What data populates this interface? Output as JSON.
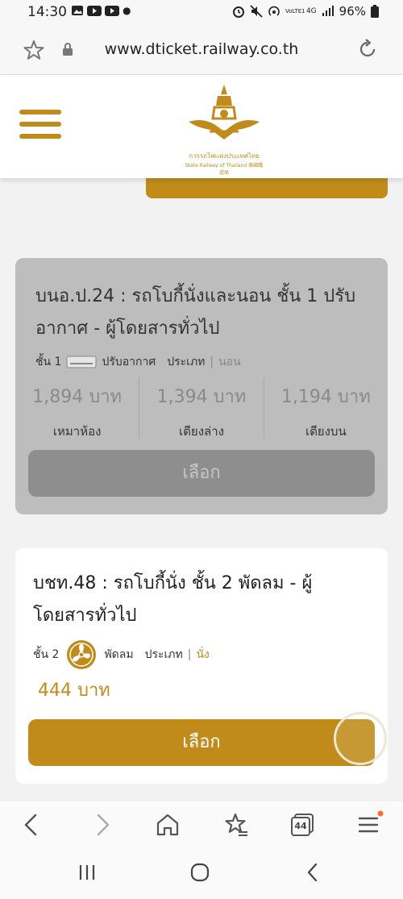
{
  "status_bar": {
    "time": "14:30",
    "network": "4G",
    "volte": "VoLTE1",
    "battery": "96%"
  },
  "browser": {
    "url": "www.dticket.railway.co.th",
    "tab_count": "44"
  },
  "header": {
    "logo_text_th": "การรถไฟแห่งประเทศไทย",
    "logo_text_en": "State Railway of Thailand 泰國鐵道局"
  },
  "card1": {
    "title": "บนอ.ป.24 : รถโบกี้นั่งและนอน ชั้น 1 ปรับอากาศ - ผู้โดยสารทั่วไป",
    "class_label": "ชั้น 1",
    "ac_label": "ปรับอากาศ",
    "type_label": "ประเภท",
    "type_value": "นอน",
    "prices": [
      {
        "amount": "1,894 บาท",
        "label": "เหมาห้อง"
      },
      {
        "amount": "1,394 บาท",
        "label": "เตียงล่าง"
      },
      {
        "amount": "1,194 บาท",
        "label": "เตียงบน"
      }
    ],
    "select_label": "เลือก"
  },
  "card2": {
    "title": "บชท.48 : รถโบกี้นั่ง ชั้น 2 พัดลม - ผู้โดยสารทั่วไป",
    "class_label": "ชั้น 2",
    "fan_label": "พัดลม",
    "type_label": "ประเภท",
    "type_value": "นั่ง",
    "price": "444 บาท",
    "select_label": "เลือก"
  },
  "colors": {
    "brand_gold": "#c08b1a",
    "disabled_card": "#bdbdbd",
    "disabled_button": "#8e8e8e"
  }
}
